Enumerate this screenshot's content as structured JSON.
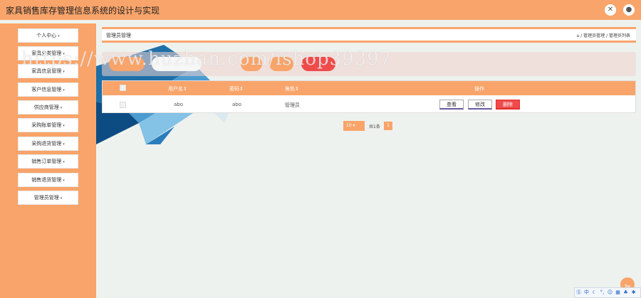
{
  "app": {
    "title": "家具销售库存管理信息系统的设计与实现"
  },
  "sidebar": {
    "items": [
      {
        "label": "个人中心"
      },
      {
        "label": "家具分类管理"
      },
      {
        "label": "家具信息管理"
      },
      {
        "label": "客户信息管理"
      },
      {
        "label": "供应商管理"
      },
      {
        "label": "采购账单管理"
      },
      {
        "label": "采购退货管理"
      },
      {
        "label": "销售订单管理"
      },
      {
        "label": "销售退货管理"
      },
      {
        "label": "管理员管理"
      }
    ]
  },
  "header": {
    "page_title": "管理员管理",
    "breadcrumb": "/ 管理员管理 / 管理员列表"
  },
  "table": {
    "headers": [
      "用户名",
      "密码",
      "角色"
    ],
    "actions_header": "操作",
    "rows": [
      {
        "username": "abo",
        "password": "abo",
        "role": "管理员"
      }
    ],
    "actions": {
      "view": "查看",
      "edit": "修改",
      "delete": "删除"
    }
  },
  "pagination": {
    "page_size": "10",
    "total": "共1条",
    "current_page": "1"
  },
  "back_to_top": "Top",
  "watermark": "https://www.huzhan.com/ishop39397",
  "colors": {
    "accent": "#f9a46a",
    "danger": "#f04a4a"
  }
}
